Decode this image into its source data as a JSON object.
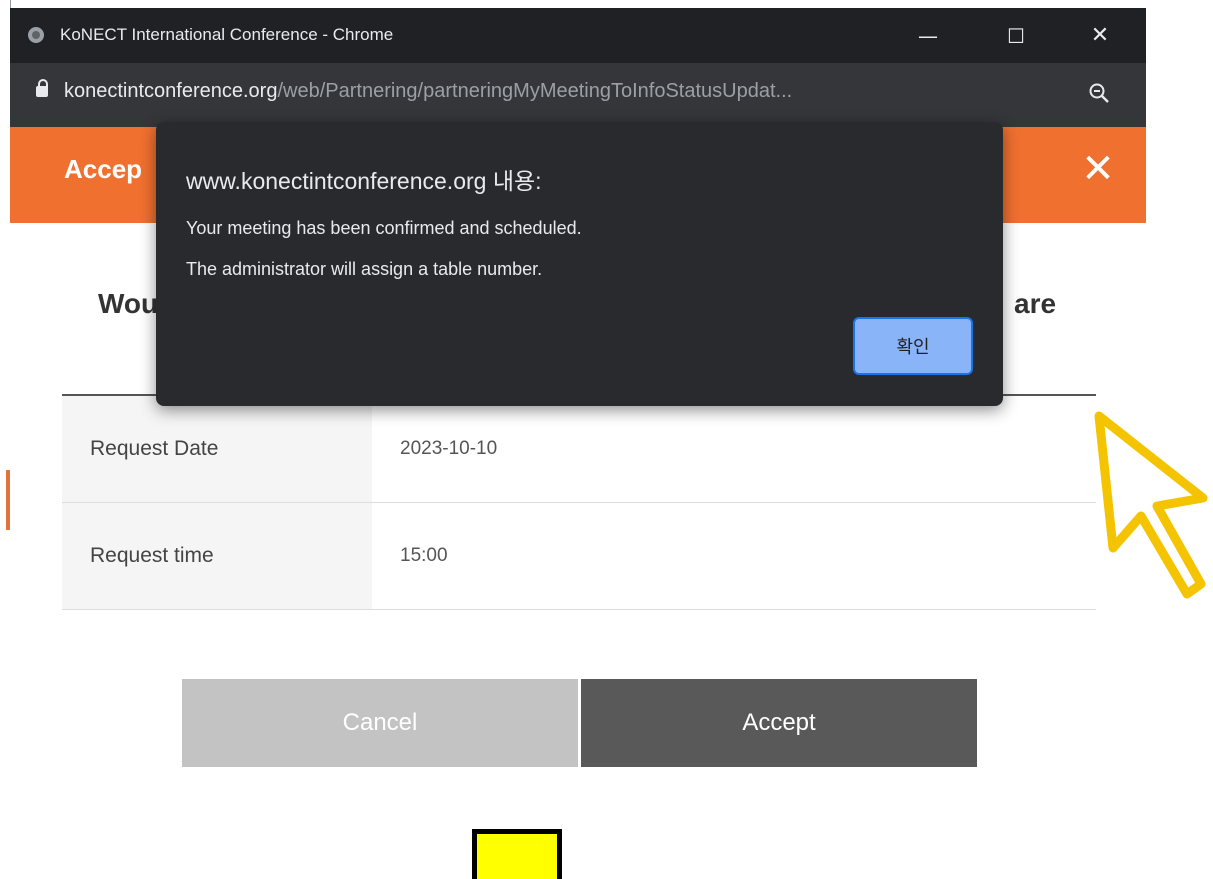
{
  "window": {
    "title": "KoNECT International Conference - Chrome",
    "minimize_glyph": "—",
    "maximize_glyph": "☐",
    "close_glyph": "✕"
  },
  "address_bar": {
    "host": "konectintconference.org",
    "path": "/web/Partnering/partneringMyMeetingToInfoStatusUpdat..."
  },
  "page": {
    "header_title": "Accep",
    "header_close_glyph": "✕",
    "question_start": "Wou",
    "question_end": "are",
    "rows": [
      {
        "label": "Request Date",
        "value": "2023-10-10"
      },
      {
        "label": "Request time",
        "value": "15:00"
      }
    ],
    "cancel_label": "Cancel",
    "accept_label": "Accept"
  },
  "dialog": {
    "title": "www.konectintconference.org 내용:",
    "message_line1": "Your meeting has been confirmed and scheduled.",
    "message_line2": "The administrator will assign a table number.",
    "ok_label": "확인"
  },
  "colors": {
    "header": "#f07030",
    "cancel": "#c3c3c3",
    "accept": "#595959",
    "dialog_bg": "#292a2d",
    "ok_button": "#8ab4f8",
    "cursor_outline": "#f5c400",
    "marker": "#ffff00"
  }
}
